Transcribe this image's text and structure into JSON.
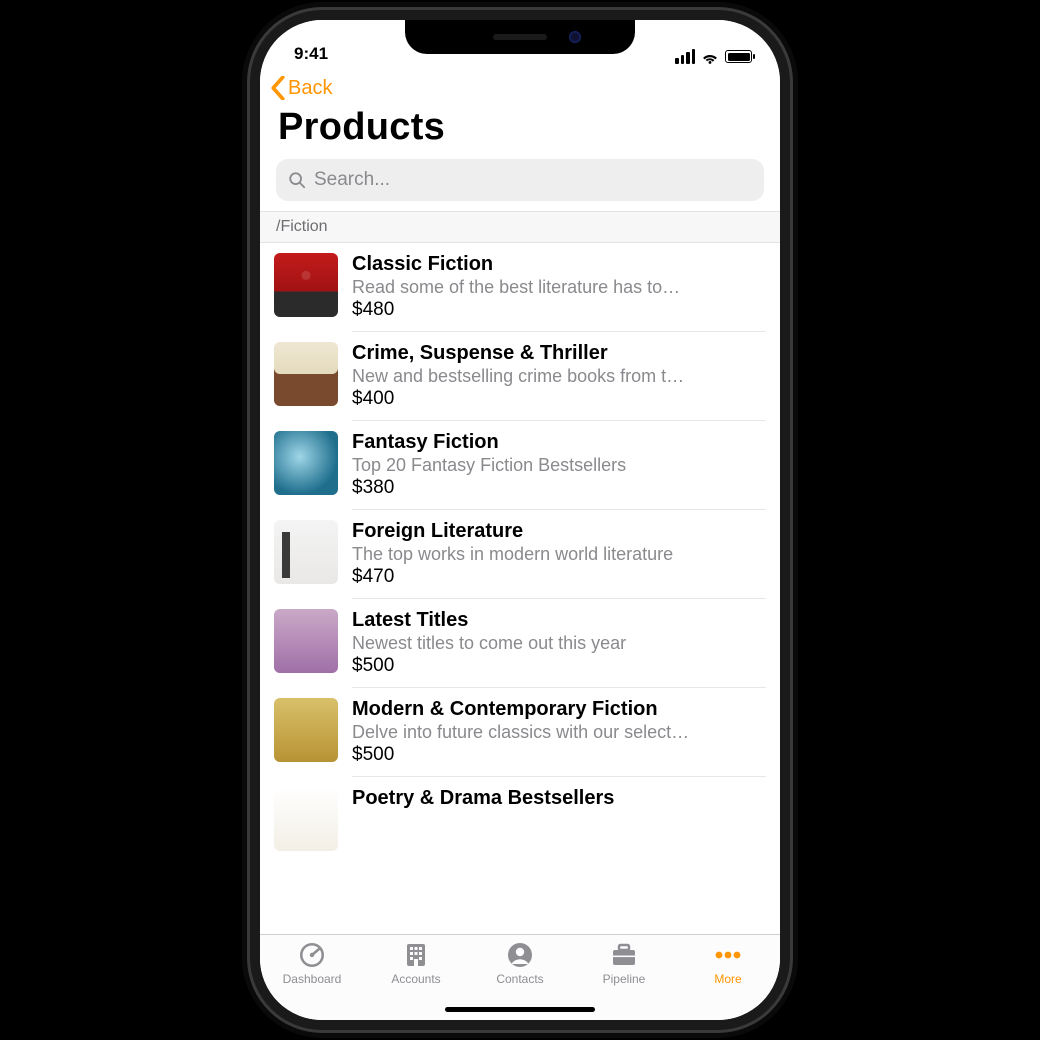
{
  "statusbar": {
    "time": "9:41"
  },
  "nav": {
    "back_label": "Back"
  },
  "page": {
    "title": "Products"
  },
  "search": {
    "placeholder": "Search..."
  },
  "section": {
    "header": "/Fiction"
  },
  "products": [
    {
      "title": "Classic Fiction",
      "subtitle": "Read some of the best literature has to…",
      "price": "$480"
    },
    {
      "title": "Crime, Suspense & Thriller",
      "subtitle": "New and bestselling crime books from t…",
      "price": "$400"
    },
    {
      "title": "Fantasy Fiction",
      "subtitle": "Top 20 Fantasy Fiction Bestsellers",
      "price": "$380"
    },
    {
      "title": "Foreign Literature",
      "subtitle": "The top works in modern world literature",
      "price": "$470"
    },
    {
      "title": "Latest Titles",
      "subtitle": "Newest titles to come out this year",
      "price": "$500"
    },
    {
      "title": "Modern & Contemporary Fiction",
      "subtitle": "Delve into future classics with our select…",
      "price": "$500"
    },
    {
      "title": "Poetry & Drama Bestsellers",
      "subtitle": "",
      "price": ""
    }
  ],
  "tabs": [
    {
      "label": "Dashboard",
      "active": false
    },
    {
      "label": "Accounts",
      "active": false
    },
    {
      "label": "Contacts",
      "active": false
    },
    {
      "label": "Pipeline",
      "active": false
    },
    {
      "label": "More",
      "active": true
    }
  ],
  "colors": {
    "accent": "#ff9500"
  }
}
